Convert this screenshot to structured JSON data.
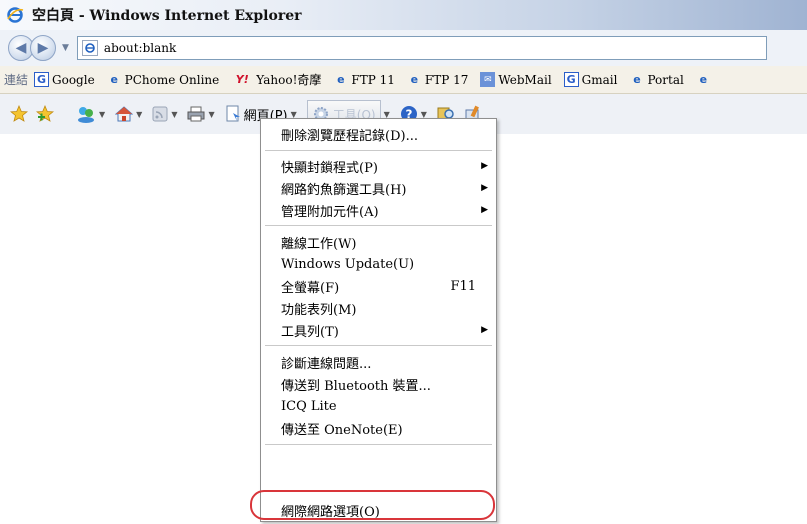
{
  "window": {
    "title": "空白頁 - Windows Internet Explorer"
  },
  "address": {
    "url": "about:blank"
  },
  "links_bar": {
    "label": "連結",
    "items": [
      {
        "label": "Google",
        "icon": "g-icon"
      },
      {
        "label": "PChome Online",
        "icon": "ie-icon"
      },
      {
        "label": "Yahoo!奇摩",
        "icon": "yahoo-icon"
      },
      {
        "label": "FTP 11",
        "icon": "ie-icon"
      },
      {
        "label": "FTP 17",
        "icon": "ie-icon"
      },
      {
        "label": "WebMail",
        "icon": "mail-icon"
      },
      {
        "label": "Gmail",
        "icon": "g-icon"
      },
      {
        "label": "Portal",
        "icon": "ie-icon"
      }
    ]
  },
  "command_bar": {
    "page_label": "網頁(P)",
    "tools_label": "工具(O)"
  },
  "tools_menu": {
    "items": [
      {
        "label": "刪除瀏覽歷程記錄(D)..."
      },
      {
        "label": "快顯封鎖程式(P)"
      },
      {
        "label": "網路釣魚篩選工具(H)"
      },
      {
        "label": "管理附加元件(A)"
      },
      {
        "label": "離線工作(W)"
      },
      {
        "label": "Windows Update(U)"
      },
      {
        "label": "全螢幕(F)",
        "accelerator": "F11"
      },
      {
        "label": "功能表列(M)"
      },
      {
        "label": "工具列(T)"
      },
      {
        "label": "診斷連線問題..."
      },
      {
        "label": "傳送到 Bluetooth 裝置..."
      },
      {
        "label": "ICQ Lite"
      },
      {
        "label": "傳送至 OneNote(E)"
      },
      {
        "label": "網際網路選項(O)"
      }
    ]
  },
  "colors": {
    "highlight_ring": "#d9353a",
    "title_gradient_end": "#9fb3d2"
  }
}
